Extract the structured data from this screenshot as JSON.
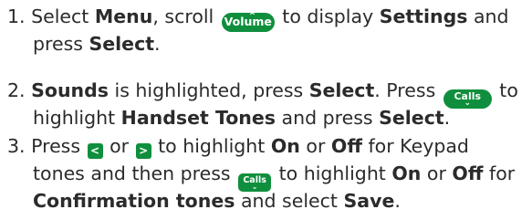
{
  "step1": {
    "number": "1.",
    "t1": "Select ",
    "menu": "Menu",
    "t2": ", scroll ",
    "volume_key": "Volume",
    "t3": " to display ",
    "settings": "Settings",
    "t4": " and",
    "t5": "press ",
    "select": "Select",
    "t6": "."
  },
  "step2": {
    "number": "2.",
    "sounds": "Sounds",
    "t1": " is highlighted, press ",
    "select1": "Select",
    "t2": ". Press ",
    "calls_key": "Calls",
    "t3": " to",
    "t4": "highlight ",
    "handset_tones": "Handset Tones",
    "t5": " and press ",
    "select2": "Select",
    "t6": "."
  },
  "step3": {
    "number": "3.",
    "t1": "Press ",
    "left_key": "<",
    "t2": " or ",
    "right_key": ">",
    "t3": " to highlight ",
    "on1": "On",
    "t4": " or ",
    "off1": "Off",
    "t5": " for Keypad",
    "t6": "tones and then press ",
    "calls_key": "Calls",
    "t7": " to highlight ",
    "on2": "On",
    "t8": " or ",
    "off2": "Off",
    "t9": " for",
    "confirmation_tones": "Confirmation tones",
    "t10": " and select ",
    "save": "Save",
    "t11": "."
  },
  "colors": {
    "key_green": "#0f8f3d",
    "text": "#2b2b2b"
  },
  "icons": {
    "volume": "volume-key-icon",
    "calls": "calls-key-icon",
    "left": "left-arrow-key-icon",
    "right": "right-arrow-key-icon"
  }
}
